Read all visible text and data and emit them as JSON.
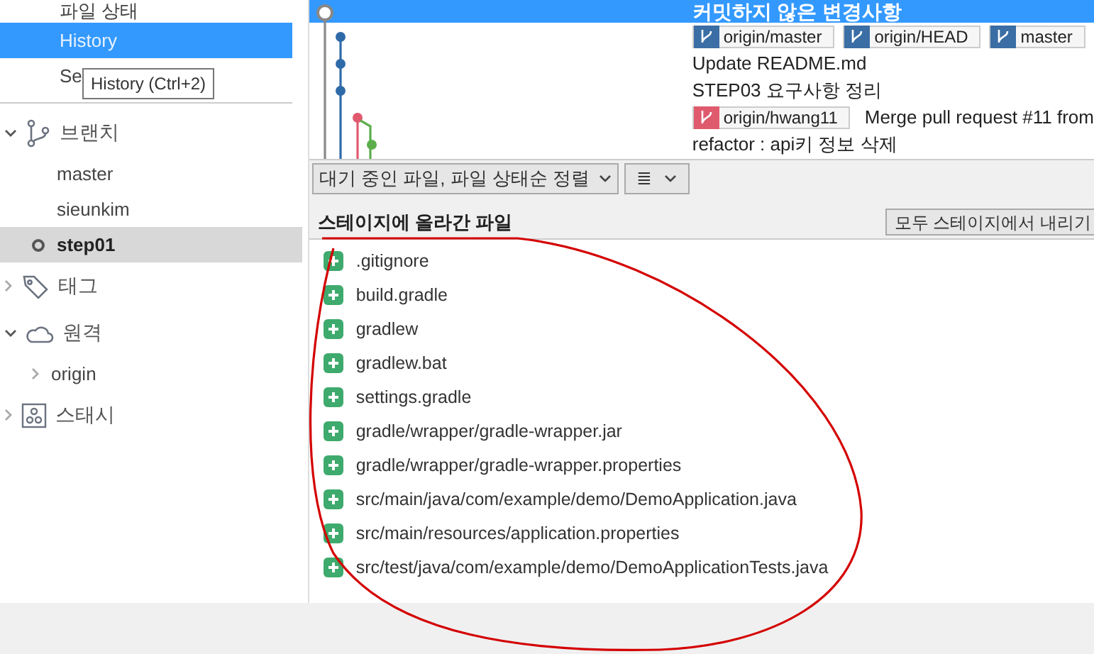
{
  "sidebar": {
    "nav_items": [
      {
        "label": "파일 상태",
        "selected": false
      },
      {
        "label": "History",
        "selected": true
      },
      {
        "label": "Se",
        "selected": false
      }
    ],
    "tooltip": "History (Ctrl+2)",
    "sections": [
      {
        "kind": "branch",
        "label": "브랜치",
        "expanded": true,
        "children": [
          {
            "label": "master",
            "current": false
          },
          {
            "label": "sieunkim",
            "current": false
          },
          {
            "label": "step01",
            "current": true
          }
        ]
      },
      {
        "kind": "tag",
        "label": "태그",
        "expanded": false
      },
      {
        "kind": "remote",
        "label": "원격",
        "expanded": true,
        "children": [
          {
            "label": "origin",
            "expandable": true
          }
        ]
      },
      {
        "kind": "stash",
        "label": "스태시",
        "expanded": false
      }
    ]
  },
  "history": {
    "commits": [
      {
        "message": "커밋하지 않은 변경사항",
        "selected": true
      },
      {
        "selected": false,
        "refs": [
          {
            "label": "origin/master",
            "color": "#3a6ea5"
          },
          {
            "label": "origin/HEAD",
            "color": "#3a6ea5"
          },
          {
            "label": "master",
            "color": "#3a6ea5"
          }
        ]
      },
      {
        "message": "Update README.md",
        "selected": false
      },
      {
        "message": "STEP03 요구사항 정리",
        "selected": false
      },
      {
        "message": "Merge pull request #11 from",
        "selected": false,
        "refs": [
          {
            "label": "origin/hwang11",
            "color": "#e05a6e"
          }
        ]
      },
      {
        "message": "refactor : api키 정보 삭제",
        "selected": false
      }
    ]
  },
  "toolbar": {
    "sort_dropdown": "대기 중인 파일, 파일 상태순 정렬",
    "view_dropdown": "≣"
  },
  "staged": {
    "title": "스테이지에 올라간 파일",
    "unstage_all_button": "모두 스테이지에서 내리기",
    "files": [
      ".gitignore",
      "build.gradle",
      "gradlew",
      "gradlew.bat",
      "settings.gradle",
      "gradle/wrapper/gradle-wrapper.jar",
      "gradle/wrapper/gradle-wrapper.properties",
      "src/main/java/com/example/demo/DemoApplication.java",
      "src/main/resources/application.properties",
      "src/test/java/com/example/demo/DemoApplicationTests.java"
    ]
  }
}
